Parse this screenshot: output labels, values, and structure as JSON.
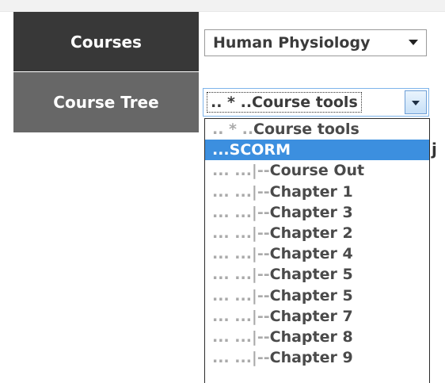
{
  "labels": {
    "courses": "Courses",
    "course_tree": "Course Tree"
  },
  "courses_select": {
    "value": "Human Physiology"
  },
  "course_tree_select": {
    "value": ".. * ..Course tools"
  },
  "dropdown": {
    "options": [
      {
        "prefix": ".. * ..",
        "label": "Course tools",
        "selected": false
      },
      {
        "prefix": "",
        "label": "...SCORM",
        "selected": true
      },
      {
        "prefix": "... ...|--",
        "label": "Course Out",
        "selected": false
      },
      {
        "prefix": "... ...|--",
        "label": "Chapter 1",
        "selected": false
      },
      {
        "prefix": "... ...|--",
        "label": "Chapter 3",
        "selected": false
      },
      {
        "prefix": "... ...|--",
        "label": "Chapter 2",
        "selected": false
      },
      {
        "prefix": "... ...|--",
        "label": "Chapter 4",
        "selected": false
      },
      {
        "prefix": "... ...|--",
        "label": "Chapter 5",
        "selected": false
      },
      {
        "prefix": "... ...|--",
        "label": "Chapter 5",
        "selected": false
      },
      {
        "prefix": "... ...|--",
        "label": "Chapter 7",
        "selected": false
      },
      {
        "prefix": "... ...|--",
        "label": "Chapter 8",
        "selected": false
      },
      {
        "prefix": "... ...|--",
        "label": "Chapter 9",
        "selected": false
      }
    ]
  },
  "cutoff_text": "j",
  "colors": {
    "courses_label_bg": "#383838",
    "tree_label_bg": "#676767",
    "selected_bg": "#3c8fdf"
  }
}
